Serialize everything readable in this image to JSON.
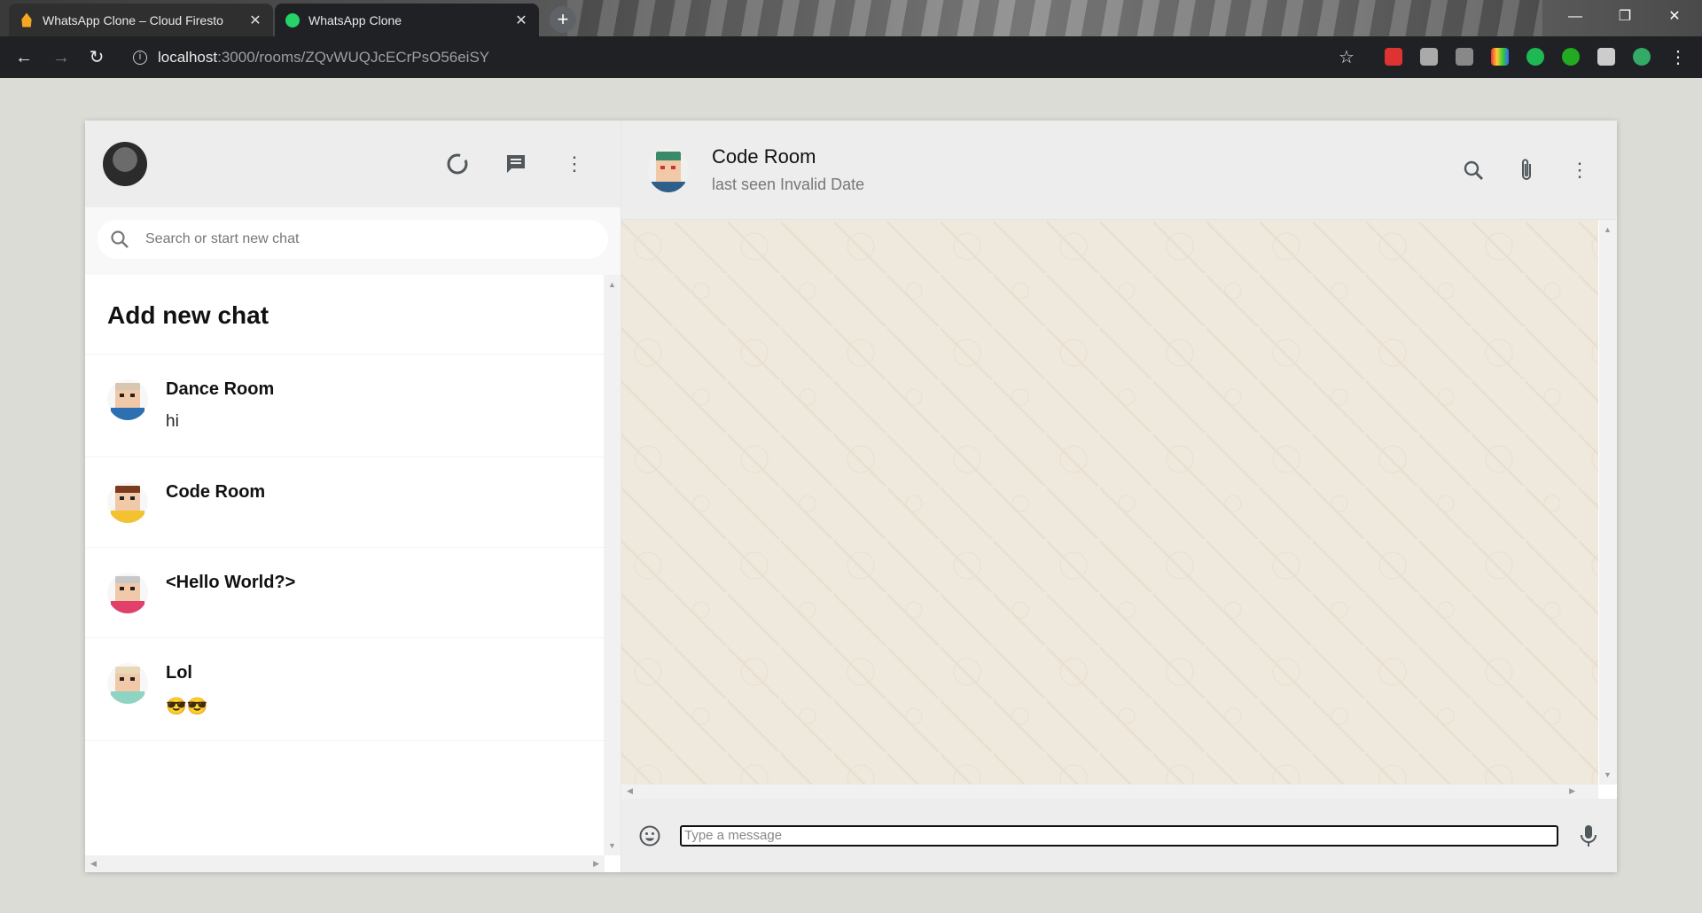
{
  "browser": {
    "tabs": [
      {
        "title": "WhatsApp Clone – Cloud Firesto",
        "active": false
      },
      {
        "title": "WhatsApp Clone",
        "active": true
      }
    ],
    "url_host": "localhost",
    "url_path": ":3000/rooms/ZQvWUQJcECrPsO56eiSY"
  },
  "sidebar": {
    "search_placeholder": "Search or start new chat",
    "add_new_chat": "Add new chat",
    "chats": [
      {
        "name": "Dance Room",
        "last_message": "hi"
      },
      {
        "name": "Code Room",
        "last_message": ""
      },
      {
        "name": "<Hello World?>",
        "last_message": ""
      },
      {
        "name": "Lol",
        "last_message": "😎😎"
      }
    ]
  },
  "chat": {
    "room_name": "Code Room",
    "last_seen": "last seen Invalid Date",
    "input_placeholder": "Type a message"
  },
  "colors": {
    "header_bg": "#ededed",
    "chat_bg": "#efe8dc",
    "icon_gray": "#51585c"
  }
}
